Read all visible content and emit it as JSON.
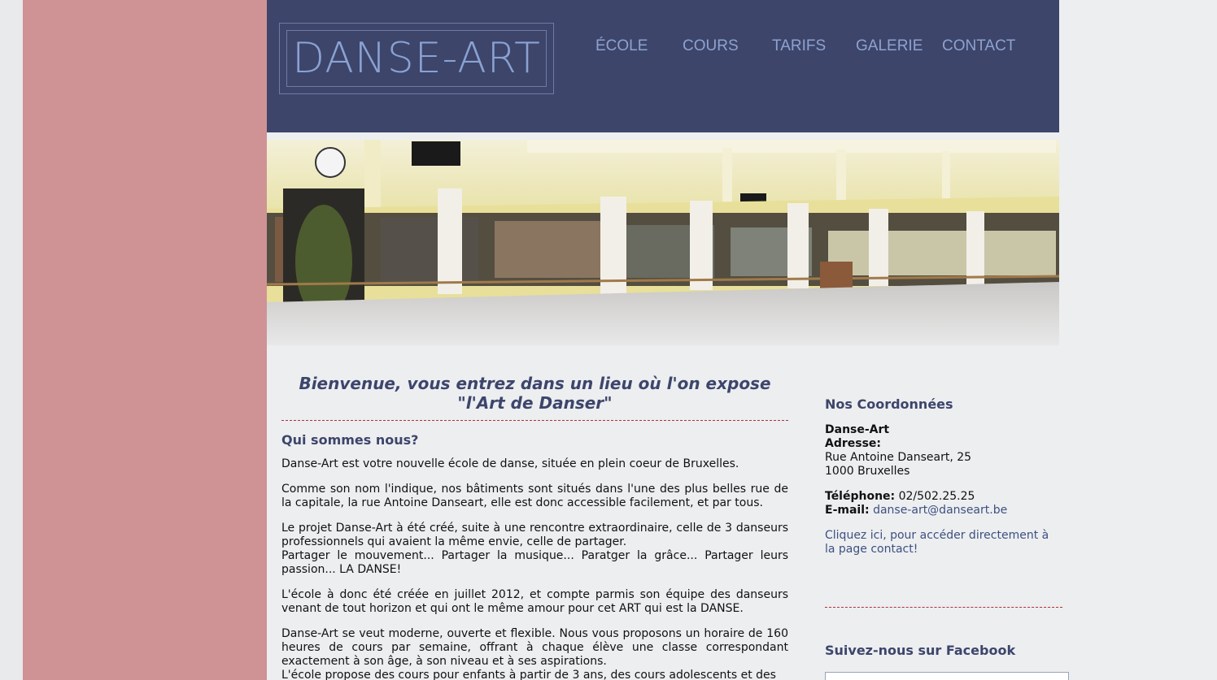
{
  "header": {
    "logo_text": "DANSE-ART",
    "nav": [
      "ÉCOLE",
      "COURS",
      "TARIFS",
      "GALERIE",
      "CONTACT"
    ]
  },
  "main": {
    "welcome_line1": "Bienvenue, vous entrez dans un lieu où l'on expose",
    "welcome_line2": "\"l'Art de Danser\"",
    "section_title": "Qui sommes nous?",
    "paragraphs": [
      "Danse-Art est votre nouvelle école de danse, située en plein coeur de Bruxelles.",
      "Comme son nom l'indique, nos bâtiments sont situés dans l'une des plus belles rue de la capitale, la rue Antoine Danseart, elle est donc accessible facilement, et par tous.",
      "Le projet Danse-Art à été créé, suite à une rencontre extraordinaire, celle de 3 danseurs professionnels qui avaient la même envie, celle de partager.",
      "Partager le mouvement... Partager la musique... Paratger la grâce... Partager leurs passion... LA DANSE!",
      "L'école à donc été créée en juillet 2012, et compte parmis son équipe des danseurs venant de tout horizon et qui ont le même amour pour cet ART qui est la DANSE.",
      "Danse-Art se veut moderne, ouverte et flexible. Nous vous proposons un horaire de 160 heures de cours par semaine, offrant à chaque élève une classe correspondant exactement à son âge, à son niveau et à ses aspirations.",
      "L'école propose des cours pour enfants à partir de 3 ans, des cours adolescents et des"
    ]
  },
  "sidebar": {
    "title": "Nos Coordonnées",
    "name": "Danse-Art",
    "address_label": "Adresse:",
    "address_street": "Rue Antoine Danseart, 25",
    "address_city": "1000 Bruxelles",
    "phone_label": "Téléphone:",
    "phone_value": "02/502.25.25",
    "email_label": "E-mail:",
    "email_value": "danse-art@danseart.be",
    "contact_link": "Cliquez ici, pour accéder directement à la page contact!",
    "facebook_title": "Suivez-nous sur Facebook"
  },
  "colors": {
    "header_bg": "#3d456b",
    "pink_panel": "#cf9395",
    "nav_text": "#8ea2cf",
    "heading": "#3d456b",
    "divider": "#b0303c"
  }
}
